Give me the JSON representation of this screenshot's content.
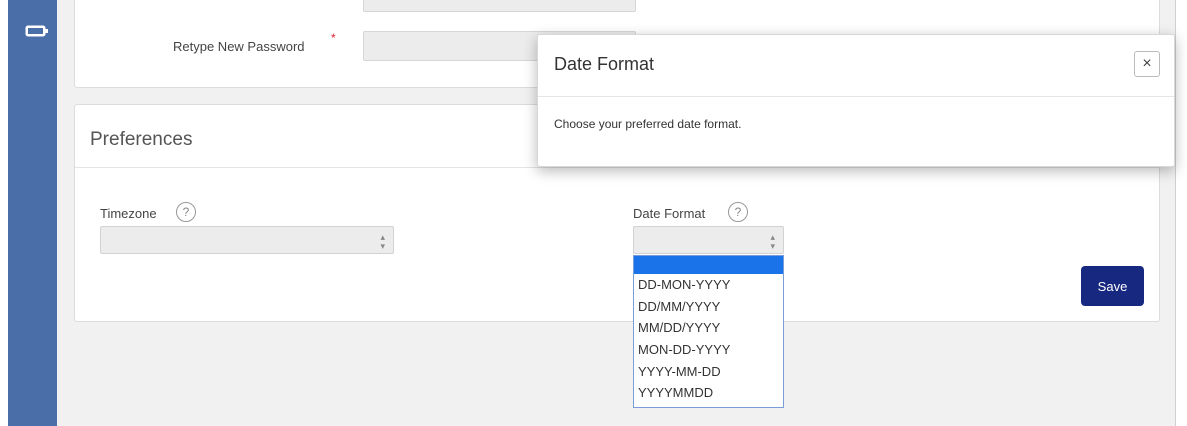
{
  "sidebar": {
    "icon": "battery-icon"
  },
  "password_card": {
    "retype_label": "Retype New Password",
    "required_marker": "*"
  },
  "preferences": {
    "title": "Preferences",
    "timezone_label": "Timezone",
    "timezone_value": "",
    "date_format_label": "Date Format",
    "date_format_value": "",
    "help_glyph": "?",
    "date_format_options": [
      "",
      "DD-MON-YYYY",
      "DD/MM/YYYY",
      "MM/DD/YYYY",
      "MON-DD-YYYY",
      "YYYY-MM-DD",
      "YYYYMMDD"
    ],
    "save_label": "Save"
  },
  "modal": {
    "title": "Date Format",
    "close_glyph": "×",
    "body": "Choose your preferred date format."
  },
  "colors": {
    "sidebar": "#4a6ea8",
    "save_button": "#162880",
    "required": "#d9232e",
    "option_highlight": "#1a73e8"
  }
}
